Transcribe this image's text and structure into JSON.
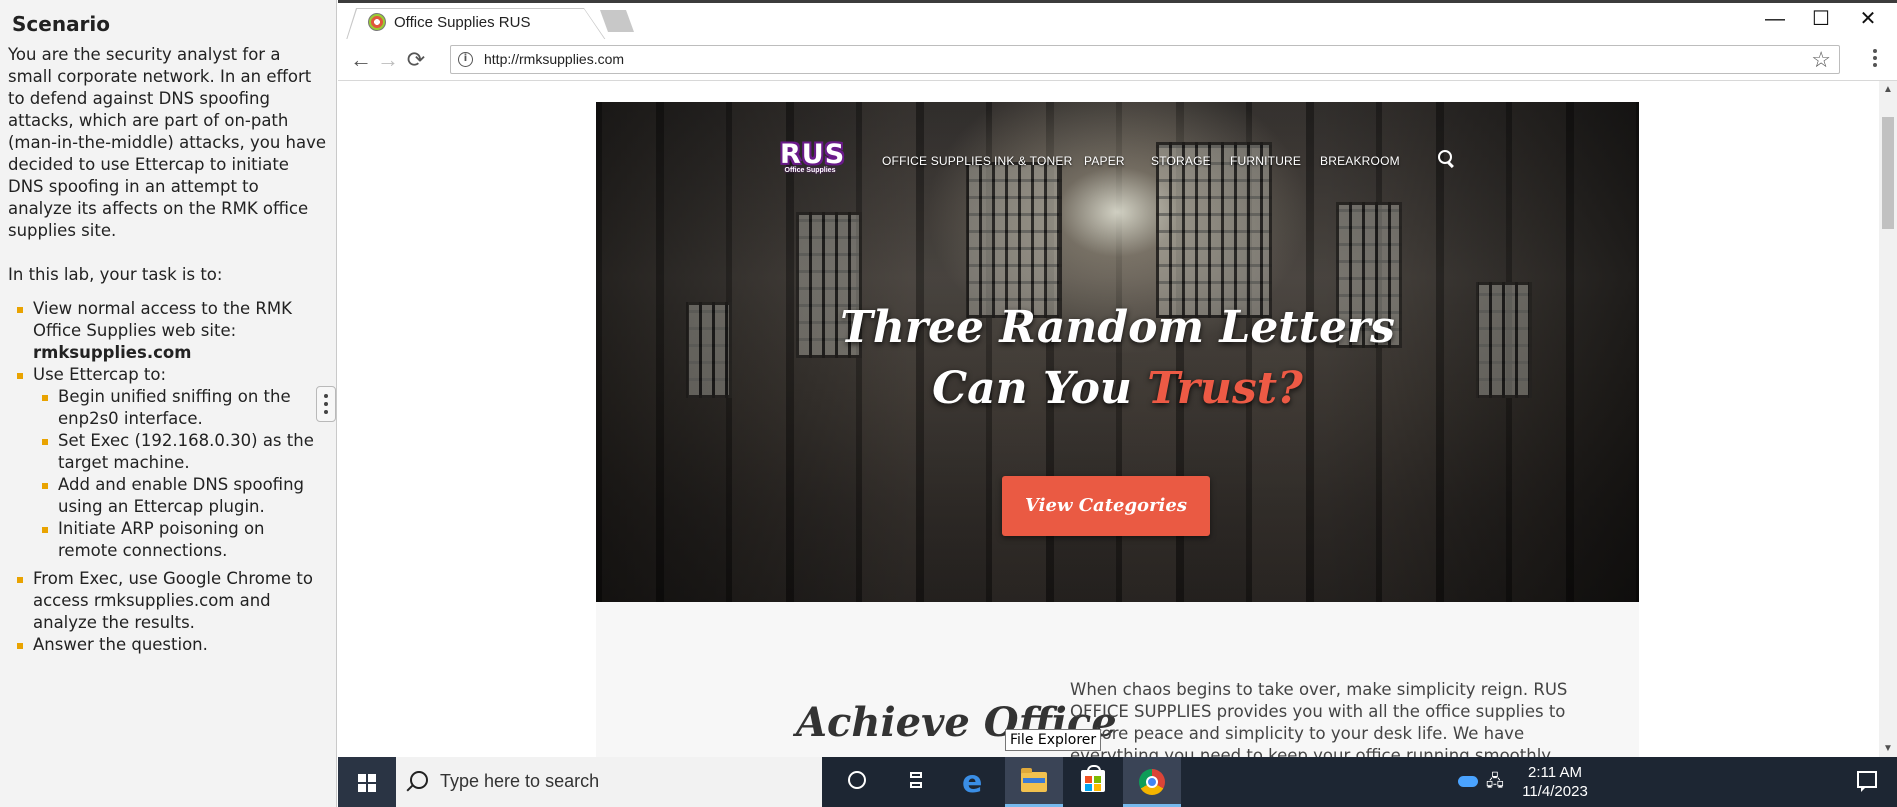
{
  "scenario": {
    "title": "Scenario",
    "intro": "You are the security analyst for a small corporate network. In an effort to defend against DNS spoofing attacks, which are part of on-path (man-in-the-middle) attacks, you have decided to use Ettercap to initiate DNS spoofing in an attempt to analyze its affects on the RMK office supplies site.",
    "task_intro": "In this lab, your task is to:",
    "task1_text": "View normal access to the RMK Office Supplies web site: ",
    "task1_bold": "rmksupplies.com",
    "task2_text": "Use Ettercap to:",
    "subtasks": [
      "Begin unified sniffing on the enp2s0 interface.",
      "Set Exec (192.168.0.30) as the target machine.",
      "Add and enable DNS spoofing using an Ettercap plugin.",
      "Initiate ARP poisoning on remote connections."
    ],
    "task3_text": "From Exec, use Google Chrome to access rmksupplies.com and analyze the results.",
    "task4_text": "Answer the question."
  },
  "browser": {
    "tab_title": "Office Supplies RUS",
    "url": "http://rmksupplies.com",
    "minimize": "—",
    "maximize": "☐",
    "close": "✕",
    "back": "←",
    "forward": "→",
    "reload": "⟳",
    "info": "i",
    "bookmark_star": "☆"
  },
  "site": {
    "logo_main": "RUS",
    "logo_sub": "Office Supplies",
    "nav": [
      "OFFICE SUPPLIES",
      "INK & TONER",
      "PAPER",
      "STORAGE",
      "FURNITURE",
      "BREAKROOM"
    ],
    "hero_line1": "Three Random Letters",
    "hero_line2_a": "Can You ",
    "hero_line2_b": "Trust?",
    "cta": "View Categories",
    "section_heading": "Achieve Office",
    "section_text": "When chaos begins to take over, make simplicity reign. RUS OFFICE SUPPLIES provides you with all the office supplies to restore peace and simplicity to your desk life. We have everything you need to keep your office running smoothly."
  },
  "tooltip": "File Explorer",
  "taskbar": {
    "search_placeholder": "Type here to search",
    "time": "2:11 AM",
    "date": "11/4/2023",
    "volume_glyph": "🔊"
  },
  "colors": {
    "accent": "#ea5a43",
    "bullet": "#e9a300",
    "taskbar": "#1d2633",
    "logo_purple": "#6a1a8a"
  }
}
